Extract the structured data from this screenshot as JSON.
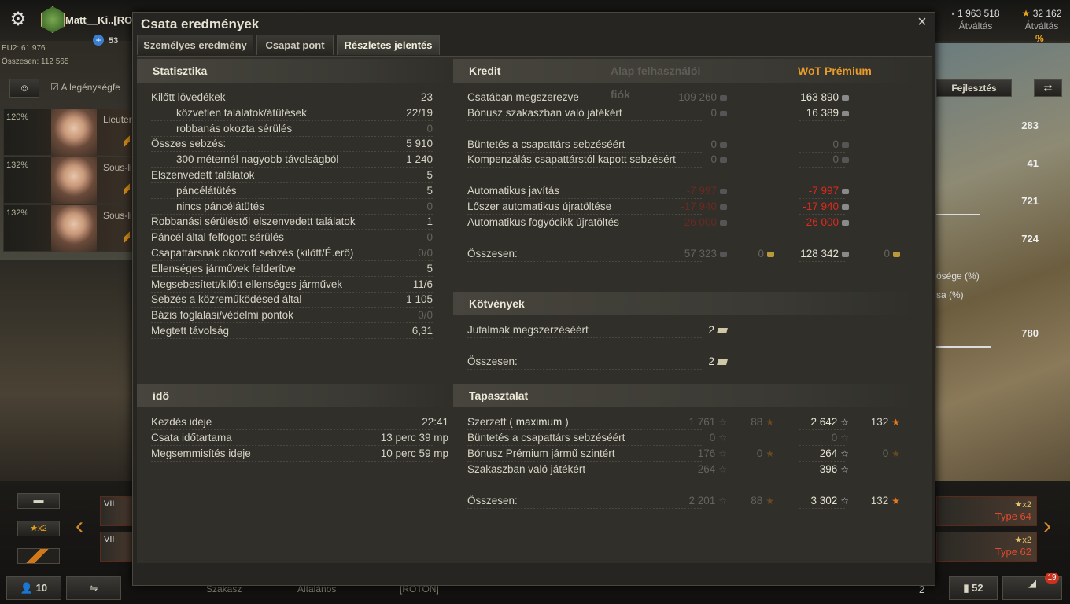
{
  "top": {
    "player_name": "Matt__Ki..[RO",
    "plus_count": "53",
    "eu2": "EU2: 61 976",
    "total": "Összesen: 112 565",
    "credits": "1 963 518",
    "credits_action": "Átváltás",
    "gold": "32 162",
    "gold_action": "Átváltás",
    "gold_badge": "%"
  },
  "left": {
    "crew_filter": "A legénységfe",
    "crew": [
      {
        "pct": "120%",
        "rank": "Lieuter"
      },
      {
        "pct": "132%",
        "rank": "Sous-li"
      },
      {
        "pct": "132%",
        "rank": "Sous-li"
      }
    ]
  },
  "right": {
    "upgrade_button": "Fejlesztés",
    "stats": [
      "283",
      "41",
      "721",
      "724",
      "780"
    ],
    "text1": "ósége (%)",
    "text2": "sa (%)"
  },
  "bottom": {
    "x2_label": "x2",
    "platoon_count": "10",
    "platoon_label": "Szakasz",
    "general_label": "Általános",
    "clan_tag": "[ROTON]",
    "count2": "2",
    "count52": "52",
    "notify": "19",
    "tier1": "VII",
    "tier2": "VII",
    "vehicles": [
      {
        "name": "Type 64",
        "xp": "x2"
      },
      {
        "name": "Type 62",
        "xp": "x2"
      }
    ]
  },
  "window": {
    "title": "Csata eredmények",
    "close": "×",
    "tabs": [
      "Személyes eredmény",
      "Csapat pont",
      "Részletes jelentés"
    ]
  },
  "stats": {
    "header": "Statisztika",
    "rows": [
      {
        "label": "Kilőtt lövedékek",
        "value": "23",
        "indent": false,
        "dim": false
      },
      {
        "label": "közvetlen találatok/átütések",
        "value": "22/19",
        "indent": true,
        "dim": false
      },
      {
        "label": "robbanás okozta sérülés",
        "value": "0",
        "indent": true,
        "dim": true
      },
      {
        "label": "Összes sebzés:",
        "value": "5 910",
        "indent": false,
        "dim": false
      },
      {
        "label": "300 méternél nagyobb távolságból",
        "value": "1 240",
        "indent": true,
        "dim": false
      },
      {
        "label": "Elszenvedett találatok",
        "value": "5",
        "indent": false,
        "dim": false
      },
      {
        "label": "páncélátütés",
        "value": "5",
        "indent": true,
        "dim": false
      },
      {
        "label": "nincs páncélátütés",
        "value": "0",
        "indent": true,
        "dim": true
      },
      {
        "label": "Robbanási sérüléstől elszenvedett találatok",
        "value": "1",
        "indent": false,
        "dim": false
      },
      {
        "label": "Páncél által felfogott sérülés",
        "value": "0",
        "indent": false,
        "dim": true
      },
      {
        "label": "Csapattársnak okozott sebzés (kilőtt/É.erő)",
        "value": "0/0",
        "indent": false,
        "dim": true
      },
      {
        "label": "Ellenséges járművek felderítve",
        "value": "5",
        "indent": false,
        "dim": false
      },
      {
        "label": "Megsebesített/kilőtt ellenséges járművek",
        "value": "11/6",
        "indent": false,
        "dim": false
      },
      {
        "label": "Sebzés a közreműködésed által",
        "value": "1 105",
        "indent": false,
        "dim": false
      },
      {
        "label": "Bázis foglalási/védelmi pontok",
        "value": "0/0",
        "indent": false,
        "dim": true
      },
      {
        "label": "Megtett távolság",
        "value": "6,31",
        "indent": false,
        "dim": false
      }
    ]
  },
  "time": {
    "header": "idő",
    "rows": [
      {
        "label": "Kezdés ideje",
        "value": "22:41"
      },
      {
        "label": "Csata időtartama",
        "value": "13 perc 39 mp"
      },
      {
        "label": "Megsemmisítés ideje",
        "value": "10 perc 59 mp"
      }
    ]
  },
  "credits": {
    "header": "Kredit",
    "col_basic": "Alap felhasználói fiók",
    "col_premium": "WoT Prémium",
    "rows": [
      {
        "label": "Csatában megszerezve",
        "basic": "109 260",
        "premium": "163 890",
        "basic_gold": "",
        "premium_gold": "",
        "style": "normal"
      },
      {
        "label": "Bónusz szakaszban való játékért",
        "basic": "0",
        "premium": "16 389",
        "basic_gold": "",
        "premium_gold": "",
        "style": "normal"
      },
      {
        "label": "Büntetés a csapattárs sebzéséért",
        "basic": "0",
        "premium": "0",
        "basic_gold": "",
        "premium_gold": "",
        "style": "zero",
        "gap": true
      },
      {
        "label": "Kompenzálás csapattárstól kapott sebzésért",
        "basic": "0",
        "premium": "0",
        "basic_gold": "",
        "premium_gold": "",
        "style": "zero"
      },
      {
        "label": "Automatikus javítás",
        "basic": "-7 997",
        "premium": "-7 997",
        "basic_gold": "",
        "premium_gold": "",
        "style": "red",
        "gap": true
      },
      {
        "label": "Lőszer automatikus újratöltése",
        "basic": "-17 940",
        "premium": "-17 940",
        "basic_gold": "",
        "premium_gold": "",
        "style": "red"
      },
      {
        "label": "Automatikus fogyócikk újratöltés",
        "basic": "-26 000",
        "premium": "-26 000",
        "basic_gold": "",
        "premium_gold": "",
        "style": "red"
      },
      {
        "label": "Összesen:",
        "basic": "57 323",
        "premium": "128 342",
        "basic_gold": "0",
        "premium_gold": "0",
        "style": "total",
        "gap": true
      }
    ]
  },
  "bonds": {
    "header": "Kötvények",
    "rows": [
      {
        "label": "Jutalmak megszerzéséért",
        "value": "2"
      },
      {
        "label": "Összesen:",
        "value": "2"
      }
    ]
  },
  "xp": {
    "header": "Tapasztalat",
    "earned_label": "Szerzett (",
    "earned_max": "maximum",
    "earned_close": ")",
    "rows": [
      {
        "label": "Szerzett",
        "basic": "1 761",
        "basic_free": "88",
        "premium": "2 642",
        "premium_free": "132",
        "style": "earned"
      },
      {
        "label": "Büntetés a csapattárs sebzéséért",
        "basic": "0",
        "basic_free": "",
        "premium": "0",
        "premium_free": "",
        "style": "zero"
      },
      {
        "label": "Bónusz Prémium jármű szintért",
        "basic": "176",
        "basic_free": "0",
        "premium": "264",
        "premium_free": "0",
        "style": "normal"
      },
      {
        "label": "Szakaszban való játékért",
        "basic": "264",
        "basic_free": "",
        "premium": "396",
        "premium_free": "",
        "style": "normal"
      },
      {
        "label": "Összesen:",
        "basic": "2 201",
        "basic_free": "88",
        "premium": "3 302",
        "premium_free": "132",
        "style": "total",
        "gap": true
      }
    ]
  }
}
